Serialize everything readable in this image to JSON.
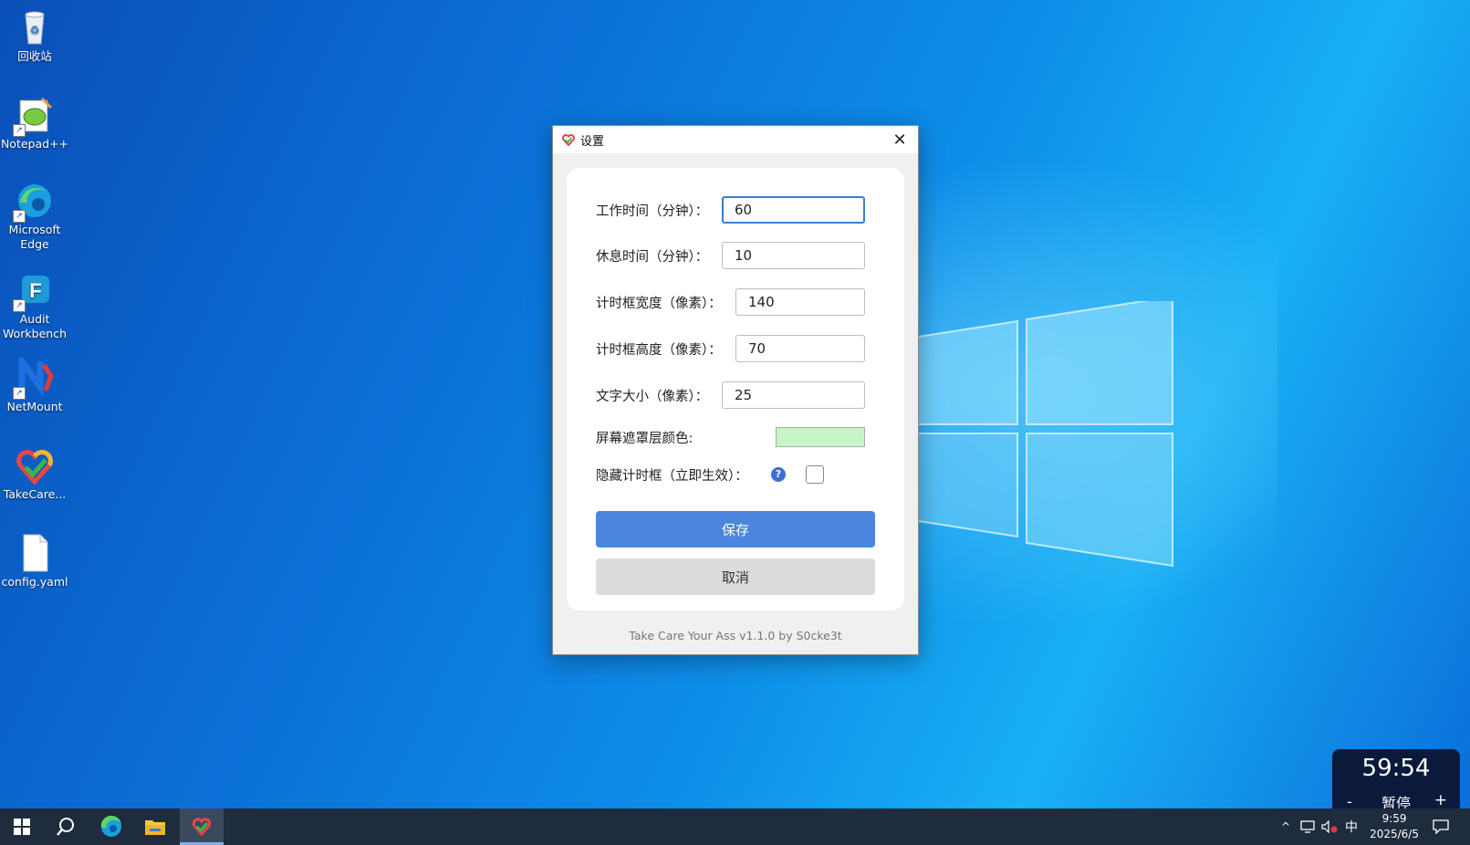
{
  "desktop": {
    "icons": [
      {
        "label": "回收站",
        "name": "recycle-bin"
      },
      {
        "label": "Notepad++",
        "name": "notepad-plus-plus"
      },
      {
        "label": "Microsoft Edge",
        "name": "microsoft-edge"
      },
      {
        "label": "Audit Workbench",
        "name": "audit-workbench"
      },
      {
        "label": "NetMount",
        "name": "netmount"
      },
      {
        "label": "TakeCare...",
        "name": "takecare"
      },
      {
        "label": "config.yaml",
        "name": "config-yaml"
      }
    ]
  },
  "dialog": {
    "title": "设置",
    "fields": {
      "work_time": {
        "label": "工作时间（分钟）：",
        "value": "60"
      },
      "rest_time": {
        "label": "休息时间（分钟）：",
        "value": "10"
      },
      "timer_width": {
        "label": "计时框宽度（像素）：",
        "value": "140"
      },
      "timer_height": {
        "label": "计时框高度（像素）：",
        "value": "70"
      },
      "font_size": {
        "label": "文字大小（像素）：",
        "value": "25"
      },
      "mask_color": {
        "label": "屏幕遮罩层颜色:",
        "color": "#c8f5c8"
      },
      "hide_timer": {
        "label": "隐藏计时框（立即生效）：",
        "help": "?",
        "checked": false
      }
    },
    "save_label": "保存",
    "cancel_label": "取消",
    "footer": "Take Care Your Ass v1.1.0  by S0cke3t"
  },
  "timer_widget": {
    "time": "59:54",
    "minus": "-",
    "pause": "暂停",
    "plus": "+"
  },
  "taskbar": {
    "input_method": "中",
    "clock_time": "9:59",
    "clock_date": "2025/6/5"
  },
  "colors": {
    "accent": "#4a86dd",
    "taskbar": "#1e2c3e",
    "timer_bg": "#0b1a3a"
  }
}
